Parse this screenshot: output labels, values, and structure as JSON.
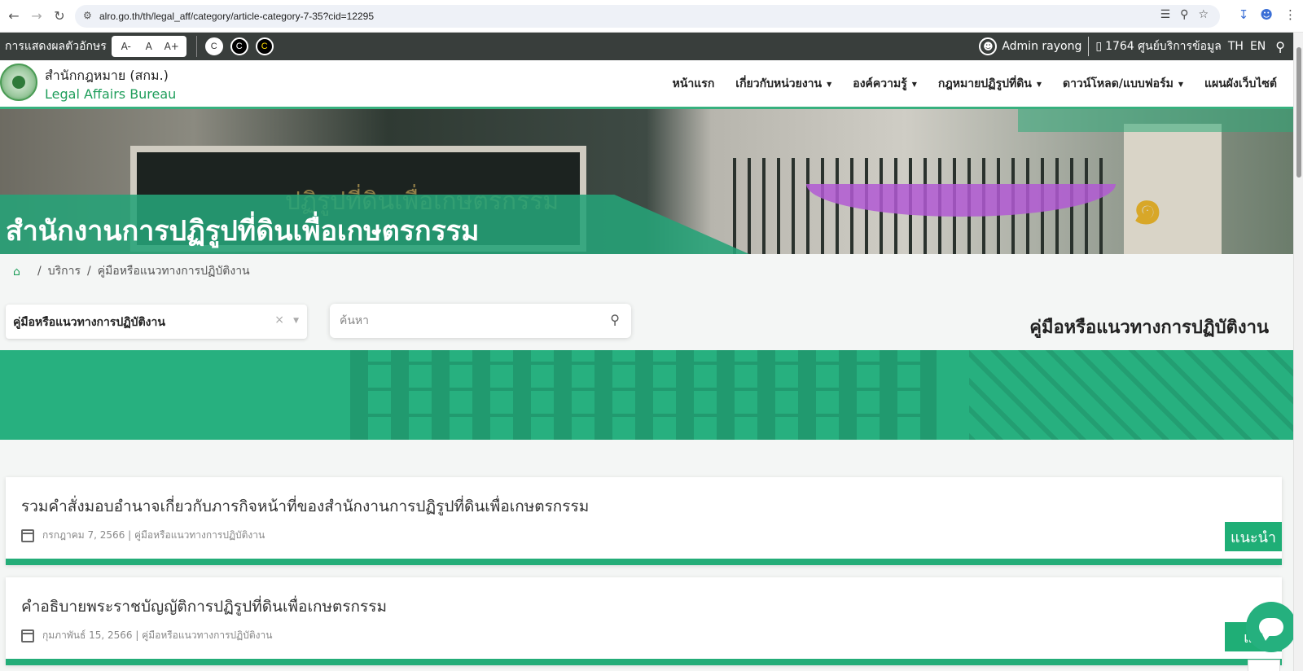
{
  "browser": {
    "url": "alro.go.th/th/legal_aff/category/article-category-7-35?cid=12295"
  },
  "access_bar": {
    "font_label": "การแสดงผลตัวอักษร",
    "font_buttons": [
      "A-",
      "A",
      "A+"
    ],
    "contrast_buttons": [
      "C",
      "C",
      "C"
    ],
    "user": "Admin rayong",
    "hotline": "1764 ศูนย์บริการข้อมูล",
    "lang_th": "TH",
    "lang_en": "EN"
  },
  "header": {
    "brand_th": "สำนักกฎหมาย (สกม.)",
    "brand_en": "Legal Affairs Bureau",
    "nav": [
      {
        "label": "หน้าแรก",
        "caret": false
      },
      {
        "label": "เกี่ยวกับหน่วยงาน",
        "caret": true
      },
      {
        "label": "องค์ความรู้",
        "caret": true
      },
      {
        "label": "กฎหมายปฏิรูปที่ดิน",
        "caret": true
      },
      {
        "label": "ดาวน์โหลด/แบบฟอร์ม",
        "caret": true
      },
      {
        "label": "แผนผังเว็บไซต์",
        "caret": false
      }
    ]
  },
  "banner": {
    "title": "สำนักงานการปฏิรูปที่ดินเพื่อเกษตรกรรม",
    "sign_text": "ปฏิรูปที่ดินเพื่อเกษตรกรรม",
    "plate_num": "๑"
  },
  "breadcrumb": {
    "items": [
      "บริการ",
      "คู่มือหรือแนวทางการปฏิบัติงาน"
    ]
  },
  "filters": {
    "category_value": "คู่มือหรือแนวทางการปฏิบัติงาน",
    "search_placeholder": "ค้นหา"
  },
  "section_title": "คู่มือหรือแนวทางการปฏิบัติงาน",
  "articles": [
    {
      "title": "รวมคำสั่งมอบอำนาจเกี่ยวกับภารกิจหน้าที่ของสำนักงานการปฏิรูปที่ดินเพื่อเกษตรกรรม",
      "meta": "กรกฎาคม 7, 2566 | คู่มือหรือแนวทางการปฏิบัติงาน",
      "tag": "แนะนำ"
    },
    {
      "title": "คำอธิบายพระราชบัญญัติการปฏิรูปที่ดินเพื่อเกษตรกรรม",
      "meta": "กุมภาพันธ์ 15, 2566 | คู่มือหรือแนวทางการปฏิบัติงาน",
      "tag": "แน"
    }
  ],
  "colors": {
    "brand_green": "#27b07f",
    "dark_bar": "#393e3c",
    "brand_text_green": "#1f9e5b"
  }
}
